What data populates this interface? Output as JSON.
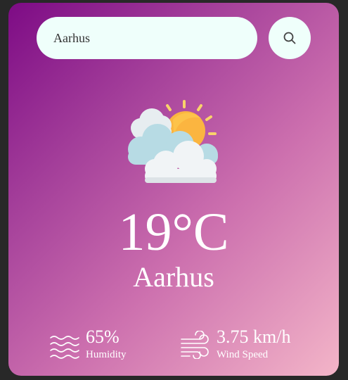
{
  "search": {
    "value": "Aarhus",
    "placeholder": "Aarhus",
    "button_icon": "search-icon"
  },
  "weather": {
    "icon": "partly-cloudy-icon",
    "temperature": "19°C",
    "city": "Aarhus"
  },
  "details": {
    "humidity": {
      "value": "65%",
      "label": "Humidity",
      "icon": "humidity-icon"
    },
    "wind": {
      "value": "3.75 km/h",
      "label": "Wind Speed",
      "icon": "wind-icon"
    }
  },
  "colors": {
    "gradient_start": "#7d0b85",
    "gradient_end": "#f3b5c8",
    "input_bg": "#effffb",
    "page_bg": "#282828"
  }
}
